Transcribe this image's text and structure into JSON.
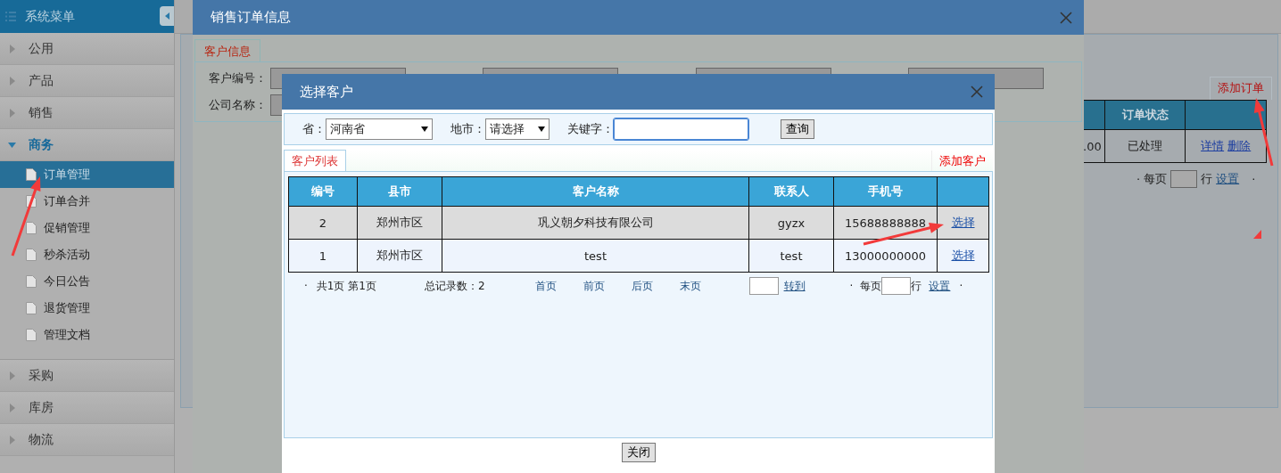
{
  "sidebar": {
    "title": "系统菜单",
    "groups": [
      {
        "label": "公用",
        "expanded": false
      },
      {
        "label": "产品",
        "expanded": false
      },
      {
        "label": "销售",
        "expanded": false
      },
      {
        "label": "商务",
        "expanded": true,
        "children": [
          {
            "label": "订单管理",
            "selected": true
          },
          {
            "label": "订单合并",
            "selected": false
          },
          {
            "label": "促销管理",
            "selected": false
          },
          {
            "label": "秒杀活动",
            "selected": false
          },
          {
            "label": "今日公告",
            "selected": false
          },
          {
            "label": "退货管理",
            "selected": false
          },
          {
            "label": "管理文档",
            "selected": false
          }
        ]
      },
      {
        "label": "采购",
        "expanded": false
      },
      {
        "label": "库房",
        "expanded": false
      },
      {
        "label": "物流",
        "expanded": false
      }
    ]
  },
  "background_page": {
    "add_tab": "添加订单",
    "columns": [
      "",
      "订单状态",
      ""
    ],
    "rows": [
      {
        "cells": [
          ".00",
          "已处理"
        ],
        "actions": [
          "详情",
          "删除"
        ]
      }
    ],
    "pager": {
      "lead_bullet": "·",
      "per_page": "每页",
      "rows_unit": "行",
      "settings": "设置",
      "trail_bullet": "·"
    }
  },
  "order_dialog": {
    "title": "销售订单信息",
    "tab": "客户信息",
    "fields": [
      {
        "label": "客户编号："
      },
      {
        "label": "公司名称："
      }
    ]
  },
  "customer_dialog": {
    "title": "选择客户",
    "filters": [
      {
        "kind": "select",
        "label": "省：",
        "value": "河南省"
      },
      {
        "kind": "select",
        "label": "地市：",
        "value": "请选择"
      },
      {
        "kind": "text",
        "label": "关键字：",
        "focused": true
      }
    ],
    "search_button": "查询",
    "list_tab": "客户列表",
    "add_link": "添加客户",
    "columns": [
      "编号",
      "县市",
      "客户名称",
      "联系人",
      "手机号"
    ],
    "rows": [
      {
        "cells": [
          "2",
          "郑州市区",
          "巩义朝夕科技有限公司",
          "gyzx",
          "15688888888"
        ],
        "action": "选择",
        "selected": true
      },
      {
        "cells": [
          "1",
          "郑州市区",
          "test",
          "test",
          "13000000000"
        ],
        "action": "选择",
        "selected": false
      }
    ],
    "pager": {
      "lead_bullet": "·",
      "page_info": "共1页 第1页",
      "total": "总记录数：2",
      "nav": [
        "首页",
        "前页",
        "后页",
        "末页"
      ],
      "goto": "转到",
      "mid_bullet": "·",
      "per_page": "每页",
      "rows_unit": "行",
      "settings": "设置",
      "trail_bullet": "·"
    },
    "close_button": "关闭"
  }
}
